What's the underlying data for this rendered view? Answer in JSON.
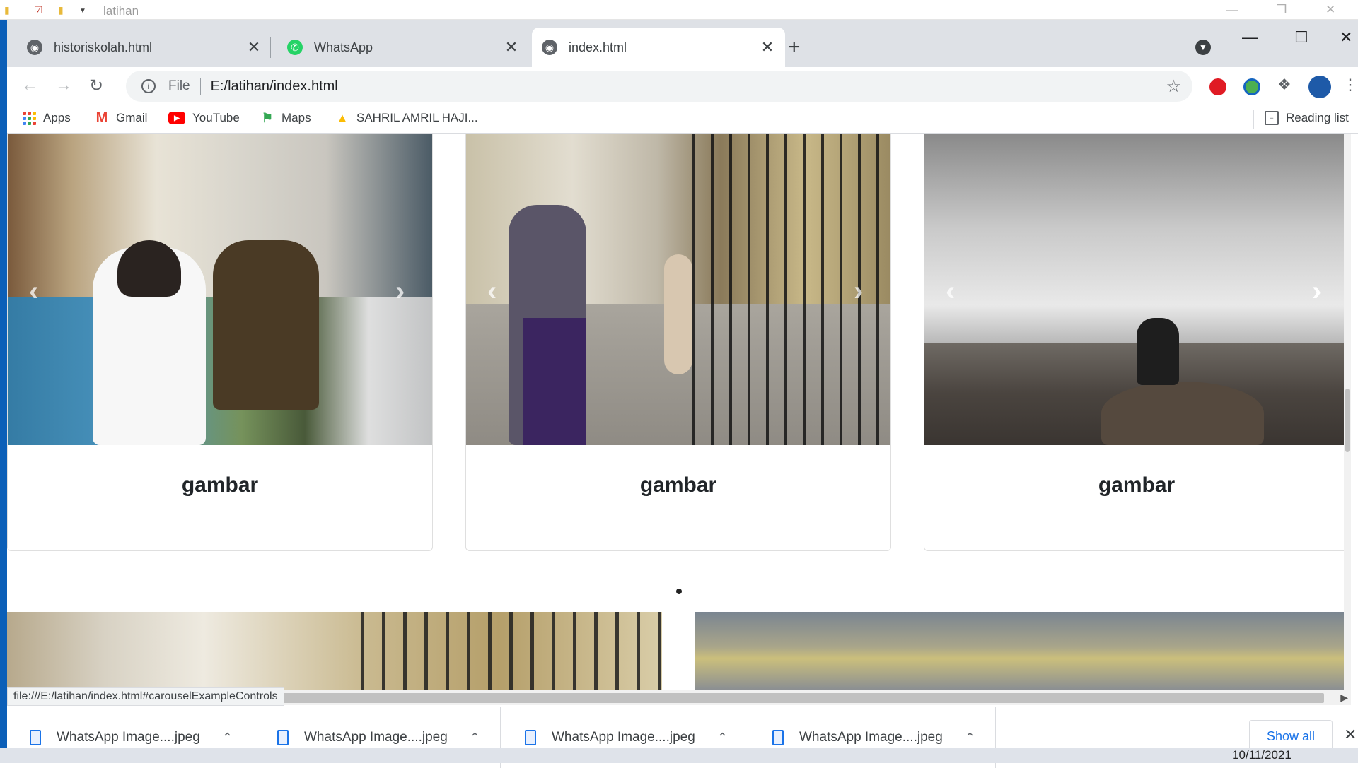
{
  "explorer": {
    "title": "latihan"
  },
  "tabs": [
    {
      "title": "historiskolah.html",
      "icon": "globe-icon"
    },
    {
      "title": "WhatsApp",
      "icon": "whatsapp-icon"
    },
    {
      "title": "index.html",
      "icon": "globe-icon",
      "active": true
    }
  ],
  "omnibox": {
    "scheme": "File",
    "url": "E:/latihan/index.html"
  },
  "bookmarks": [
    {
      "label": "Apps",
      "icon": "apps-grid-icon"
    },
    {
      "label": "Gmail",
      "icon": "gmail-icon"
    },
    {
      "label": "YouTube",
      "icon": "youtube-icon"
    },
    {
      "label": "Maps",
      "icon": "maps-icon"
    },
    {
      "label": "SAHRIL AMRIL HAJI...",
      "icon": "drive-icon"
    }
  ],
  "reading_list": "Reading list",
  "cards": [
    {
      "caption": "gambar"
    },
    {
      "caption": "gambar"
    },
    {
      "caption": "gambar"
    }
  ],
  "status_url": "file:///E:/latihan/index.html#carouselExampleControls",
  "downloads": [
    {
      "name": "WhatsApp Image....jpeg"
    },
    {
      "name": "WhatsApp Image....jpeg"
    },
    {
      "name": "WhatsApp Image....jpeg"
    },
    {
      "name": "WhatsApp Image....jpeg"
    }
  ],
  "show_all": "Show all",
  "taskbar": {
    "date": "10/11/2021"
  },
  "colors": {
    "tabstrip": "#dee1e6",
    "accent": "#1a73e8",
    "explorer_edge": "#0b5fb8"
  }
}
